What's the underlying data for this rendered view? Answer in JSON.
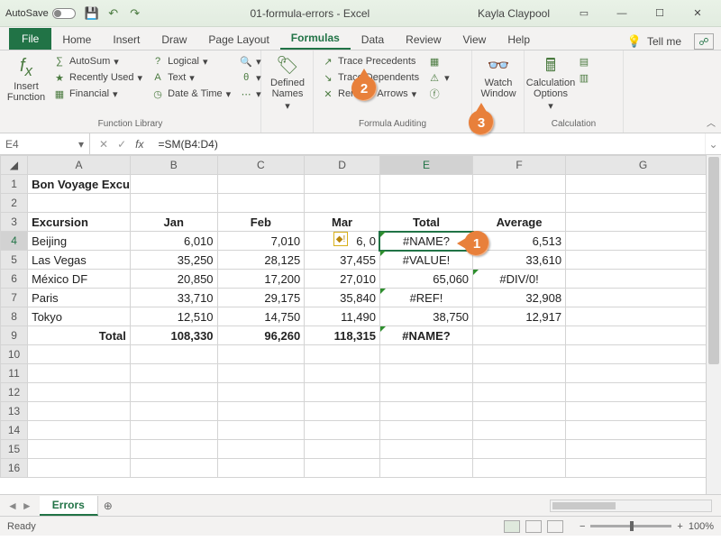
{
  "titlebar": {
    "autosave": "AutoSave",
    "title": "01-formula-errors - Excel",
    "user": "Kayla Claypool"
  },
  "tabs": {
    "file": "File",
    "items": [
      "Home",
      "Insert",
      "Draw",
      "Page Layout",
      "Formulas",
      "Data",
      "Review",
      "View",
      "Help"
    ],
    "active": "Formulas",
    "tellme": "Tell me"
  },
  "ribbon": {
    "insert_fn": "Insert\nFunction",
    "lib": {
      "autosum": "AutoSum",
      "recent": "Recently Used",
      "financial": "Financial",
      "logical": "Logical",
      "text": "Text",
      "datetime": "Date & Time",
      "label": "Function Library"
    },
    "defnames": "Defined\nNames",
    "audit": {
      "prec": "Trace Precedents",
      "dep": "Trace Dependents",
      "remove": "Remove Arrows",
      "label": "Formula Auditing"
    },
    "watch": "Watch\nWindow",
    "calc": {
      "opts": "Calculation\nOptions",
      "label": "Calculation"
    }
  },
  "fbar": {
    "name": "E4",
    "formula": "=SM(B4:D4)"
  },
  "columns": [
    "A",
    "B",
    "C",
    "D",
    "E",
    "F",
    "G"
  ],
  "rows": {
    "1": {
      "A": "Bon Voyage Excursions"
    },
    "3": {
      "A": "Excursion",
      "B": "Jan",
      "C": "Feb",
      "D": "Mar",
      "E": "Total",
      "F": "Average"
    },
    "4": {
      "A": "Beijing",
      "B": "6,010",
      "C": "7,010",
      "D": "6,    0",
      "E": "#NAME?",
      "F": "6,513"
    },
    "5": {
      "A": "Las Vegas",
      "B": "35,250",
      "C": "28,125",
      "D": "37,455",
      "E": "#VALUE!",
      "F": "33,610"
    },
    "6": {
      "A": "México DF",
      "B": "20,850",
      "C": "17,200",
      "D": "27,010",
      "E": "65,060",
      "F": "#DIV/0!"
    },
    "7": {
      "A": "Paris",
      "B": "33,710",
      "C": "29,175",
      "D": "35,840",
      "E": "#REF!",
      "F": "32,908"
    },
    "8": {
      "A": "Tokyo",
      "B": "12,510",
      "C": "14,750",
      "D": "11,490",
      "E": "38,750",
      "F": "12,917"
    },
    "9": {
      "A": "Total",
      "B": "108,330",
      "C": "96,260",
      "D": "118,315",
      "E": "#NAME?"
    }
  },
  "sheet": {
    "name": "Errors"
  },
  "status": {
    "ready": "Ready",
    "zoom": "100%"
  },
  "callouts": {
    "c1": "1",
    "c2": "2",
    "c3": "3"
  },
  "chart_data": {
    "type": "table",
    "title": "Bon Voyage Excursions",
    "columns": [
      "Excursion",
      "Jan",
      "Feb",
      "Mar",
      "Total",
      "Average"
    ],
    "rows": [
      {
        "Excursion": "Beijing",
        "Jan": 6010,
        "Feb": 7010,
        "Mar": null,
        "Total": "#NAME?",
        "Average": 6513
      },
      {
        "Excursion": "Las Vegas",
        "Jan": 35250,
        "Feb": 28125,
        "Mar": 37455,
        "Total": "#VALUE!",
        "Average": 33610
      },
      {
        "Excursion": "México DF",
        "Jan": 20850,
        "Feb": 17200,
        "Mar": 27010,
        "Total": 65060,
        "Average": "#DIV/0!"
      },
      {
        "Excursion": "Paris",
        "Jan": 33710,
        "Feb": 29175,
        "Mar": 35840,
        "Total": "#REF!",
        "Average": 32908
      },
      {
        "Excursion": "Tokyo",
        "Jan": 12510,
        "Feb": 14750,
        "Mar": 11490,
        "Total": 38750,
        "Average": 12917
      },
      {
        "Excursion": "Total",
        "Jan": 108330,
        "Feb": 96260,
        "Mar": 118315,
        "Total": "#NAME?",
        "Average": null
      }
    ]
  }
}
